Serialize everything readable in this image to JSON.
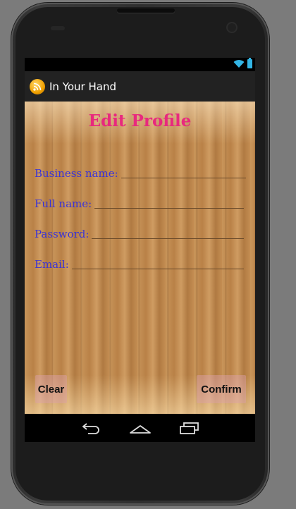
{
  "app": {
    "title": "In Your Hand",
    "icon": "rss-feed-icon",
    "accent": "#e8297e",
    "label_color": "#3a33d6"
  },
  "status_bar": {
    "icons": [
      "wifi-icon",
      "battery-icon"
    ]
  },
  "form": {
    "title": "Edit Profile",
    "fields": [
      {
        "label": "Business name:",
        "value": "",
        "placeholder": ""
      },
      {
        "label": "Full name:",
        "value": "",
        "placeholder": ""
      },
      {
        "label": "Password:",
        "value": "",
        "placeholder": ""
      },
      {
        "label": "Email:",
        "value": "",
        "placeholder": ""
      }
    ],
    "buttons": {
      "clear": "Clear",
      "confirm": "Confirm"
    }
  },
  "navigation_bar": {
    "icons": [
      "back-icon",
      "home-icon",
      "recent-apps-icon"
    ]
  }
}
